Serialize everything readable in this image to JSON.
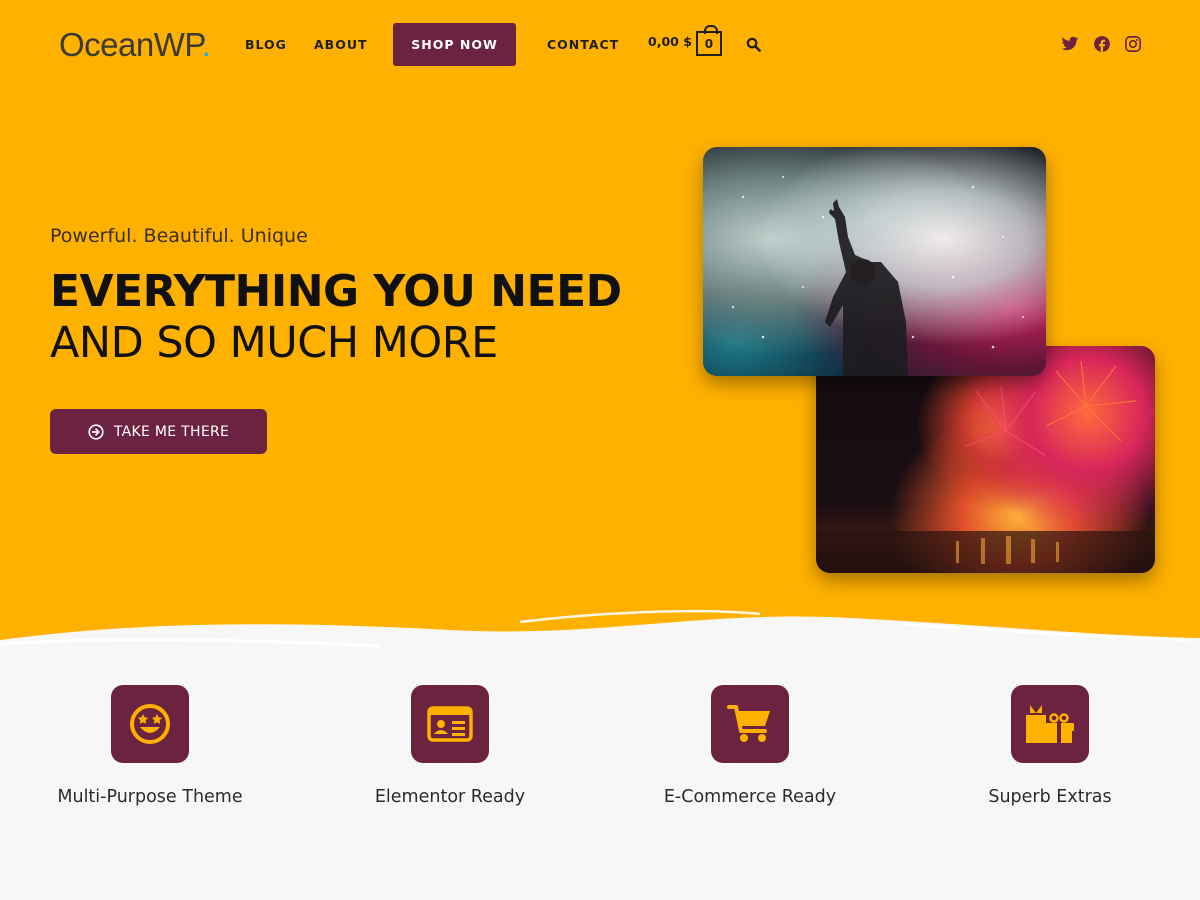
{
  "brand": {
    "name": "OceanWP",
    "dot": ".",
    "accent": "#13aff0"
  },
  "colors": {
    "hero_bg": "#ffb100",
    "primary": "#6c233f",
    "page_bg": "#f7f7f7"
  },
  "nav": {
    "blog": "BLOG",
    "about": "ABOUT",
    "shop_now": "SHOP NOW",
    "contact": "CONTACT"
  },
  "cart": {
    "price": "0,00 $",
    "count": "0"
  },
  "icons": {
    "search": "search-icon",
    "social": [
      "twitter-icon",
      "facebook-icon",
      "instagram-icon"
    ],
    "cta": "circle-arrow-right-icon",
    "features": [
      "grin-stars-icon",
      "id-card-icon",
      "shopping-cart-icon",
      "gifts-icon"
    ]
  },
  "hero": {
    "tagline": "Powerful. Beautiful. Unique",
    "headline_bold": "EVERYTHING YOU NEED",
    "headline_light": "AND SO MUCH MORE",
    "cta_label": "TAKE ME THERE"
  },
  "features": [
    {
      "label": "Multi-Purpose Theme"
    },
    {
      "label": "Elementor Ready"
    },
    {
      "label": "E-Commerce Ready"
    },
    {
      "label": "Superb Extras"
    }
  ]
}
